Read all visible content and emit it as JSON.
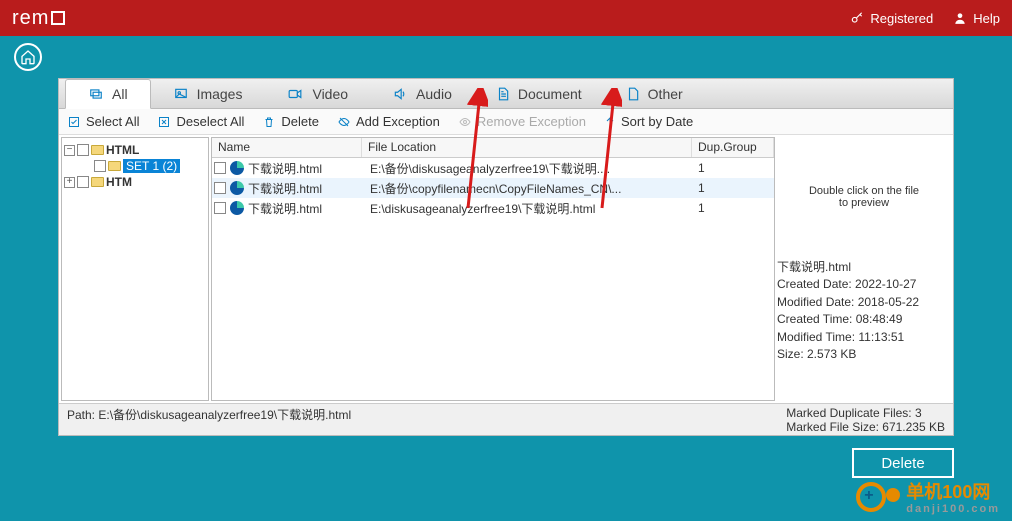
{
  "top": {
    "logo": "rem",
    "registered": "Registered",
    "help": "Help"
  },
  "tabs": {
    "all": "All",
    "images": "Images",
    "video": "Video",
    "audio": "Audio",
    "document": "Document",
    "other": "Other"
  },
  "toolbar": {
    "select_all": "Select All",
    "deselect_all": "Deselect All",
    "delete": "Delete",
    "add_exception": "Add Exception",
    "remove_exception": "Remove Exception",
    "sort_by_date": "Sort by Date"
  },
  "tree": {
    "n1": "HTML",
    "n2": "SET 1 (2)",
    "n3": "HTM"
  },
  "grid": {
    "headers": {
      "name": "Name",
      "loc": "File Location",
      "grp": "Dup.Group"
    },
    "rows": [
      {
        "name": "下载说明.html",
        "loc": "E:\\备份\\diskusageanalyzerfree19\\下载说明....",
        "grp": "1"
      },
      {
        "name": "下载说明.html",
        "loc": "E:\\备份\\copyfilenamecn\\CopyFileNames_CN\\...",
        "grp": "1"
      },
      {
        "name": "下载说明.html",
        "loc": "E:\\diskusageanalyzerfree19\\下载说明.html",
        "grp": "1"
      }
    ]
  },
  "preview": {
    "msg1": "Double click on the file",
    "msg2": "to preview"
  },
  "details": {
    "filename": "下载说明.html",
    "created_date": "Created Date: 2022-10-27",
    "modified_date": "Modified Date: 2018-05-22",
    "created_time": "Created Time: 08:48:49",
    "modified_time": "Modified Time: 11:13:51",
    "size": "Size: 2.573   KB"
  },
  "status": {
    "path": "Path:  E:\\备份\\diskusageanalyzerfree19\\下载说明.html",
    "marked_files": "Marked Duplicate Files: 3",
    "marked_size": "Marked File Size: 671.235 KB"
  },
  "delete_btn": "Delete",
  "watermark": {
    "name": "单机100网",
    "sub": "danji100.com"
  }
}
